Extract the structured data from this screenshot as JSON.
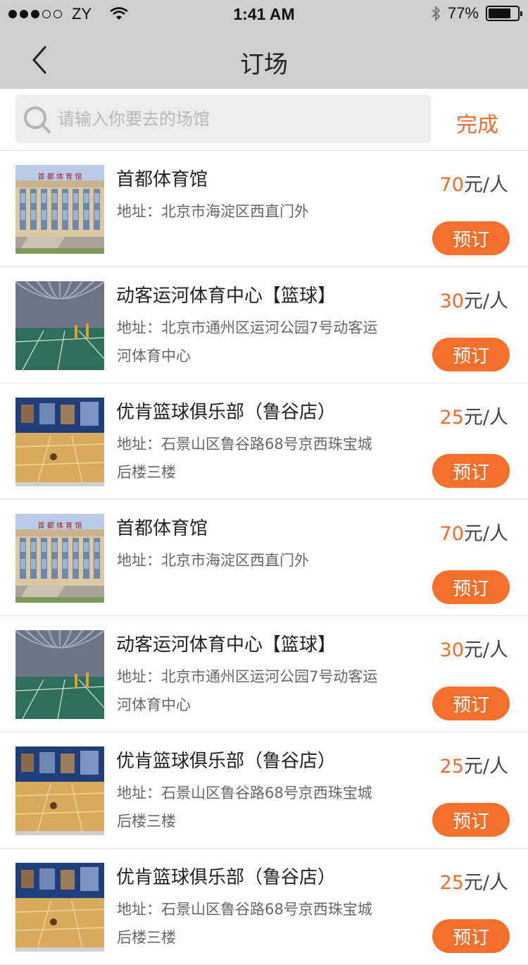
{
  "status_bar": {
    "carrier": "ZY",
    "time": "1:41 AM",
    "battery_percent": "77%",
    "battery_level": 0.77,
    "signal_bars": 3,
    "signal_total": 5
  },
  "nav": {
    "title": "订场",
    "back_icon": "chevron-left-icon"
  },
  "search": {
    "placeholder": "请输入你要去的场馆",
    "value": "",
    "done_label": "完成",
    "icon": "search-icon"
  },
  "colors": {
    "accent": "#f26b2a",
    "button": "#f56f2c",
    "bar": "#cfcfcf"
  },
  "venues": [
    {
      "name": "首都体育馆",
      "address": "地址：北京市海淀区西直门外",
      "price_value": "70",
      "price_unit": "元/人",
      "book_label": "预订",
      "thumb": "gym-building"
    },
    {
      "name": "动客运河体育中心【篮球】",
      "address": "地址：北京市通州区运河公园7号动客运河体育中心",
      "price_value": "30",
      "price_unit": "元/人",
      "book_label": "预订",
      "thumb": "indoor-court"
    },
    {
      "name": "优肯篮球俱乐部（鲁谷店）",
      "address": "地址：石景山区鲁谷路68号京西珠宝城后楼三楼",
      "price_value": "25",
      "price_unit": "元/人",
      "book_label": "预订",
      "thumb": "basketball-floor"
    },
    {
      "name": "首都体育馆",
      "address": "地址：北京市海淀区西直门外",
      "price_value": "70",
      "price_unit": "元/人",
      "book_label": "预订",
      "thumb": "gym-building"
    },
    {
      "name": "动客运河体育中心【篮球】",
      "address": "地址：北京市通州区运河公园7号动客运河体育中心",
      "price_value": "30",
      "price_unit": "元/人",
      "book_label": "预订",
      "thumb": "indoor-court"
    },
    {
      "name": "优肯篮球俱乐部（鲁谷店）",
      "address": "地址：石景山区鲁谷路68号京西珠宝城后楼三楼",
      "price_value": "25",
      "price_unit": "元/人",
      "book_label": "预订",
      "thumb": "basketball-floor"
    },
    {
      "name": "优肯篮球俱乐部（鲁谷店）",
      "address": "地址：石景山区鲁谷路68号京西珠宝城后楼三楼",
      "price_value": "25",
      "price_unit": "元/人",
      "book_label": "预订",
      "thumb": "basketball-floor"
    }
  ]
}
